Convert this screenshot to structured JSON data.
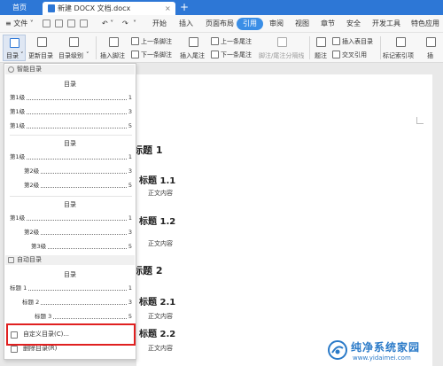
{
  "titlebar": {
    "home_tab": "首页",
    "doc_tab": "新建 DOCX 文档.docx",
    "close": "×",
    "add": "+"
  },
  "menu": {
    "file": "≡ 文件 ˅",
    "items": [
      "开始",
      "插入",
      "页面布局",
      "引用",
      "审阅",
      "视图",
      "章节",
      "安全",
      "开发工具",
      "特色应用"
    ],
    "active": "引用"
  },
  "ribbon": {
    "toc": "目录",
    "update_toc": "更新目录",
    "toc_level": "目录级别",
    "insert_footnote": "插入脚注",
    "prev_footnote": "上一条脚注",
    "next_footnote": "下一条脚注",
    "insert_endnote": "插入尾注",
    "prev_endnote": "上一条尾注",
    "next_endnote": "下一条尾注",
    "footnote_separator": "脚注/尾注分隔线",
    "caption": "题注",
    "insert_table_of_figures": "插入表目录",
    "cross_reference": "交叉引用",
    "mark_index": "标记索引项",
    "insert_index": "插"
  },
  "toc_dropdown": {
    "smart_toc_header": "智能目录",
    "blocks": [
      {
        "title": "目录",
        "lines": [
          {
            "label": "第1级",
            "page": "1"
          },
          {
            "label": "第1级",
            "page": "3"
          },
          {
            "label": "第1级",
            "page": "5"
          }
        ]
      },
      {
        "title": "目录",
        "lines": [
          {
            "label": "第1级",
            "page": "1"
          },
          {
            "label": "第2级",
            "page": "3"
          },
          {
            "label": "第2级",
            "page": "5"
          }
        ]
      },
      {
        "title": "目录",
        "lines": [
          {
            "label": "第1级",
            "page": "1"
          },
          {
            "label": "第2级",
            "page": "3"
          },
          {
            "label": "第3级",
            "page": "5"
          }
        ]
      }
    ],
    "auto_toc_header": "自动目录",
    "auto_block": {
      "title": "目录",
      "lines": [
        {
          "label": "标题 1",
          "page": "1"
        },
        {
          "label": "标题 2",
          "page": "3"
        },
        {
          "label": "标题 3",
          "page": "5"
        }
      ]
    },
    "custom_toc": "自定义目录(C)...",
    "delete_toc": "删除目录(R)"
  },
  "document": {
    "items": [
      {
        "type": "h1",
        "text": "标题 1"
      },
      {
        "type": "h2",
        "text": "标题 1.1"
      },
      {
        "type": "body",
        "text": "正文内容"
      },
      {
        "type": "h2",
        "text": "标题 1.2"
      },
      {
        "type": "body",
        "text": "正文内容"
      },
      {
        "type": "h1",
        "text": "标题 2"
      },
      {
        "type": "h2",
        "text": "标题 2.1"
      },
      {
        "type": "body",
        "text": "正文内容"
      },
      {
        "type": "h2",
        "text": "标题 2.2"
      },
      {
        "type": "body",
        "text": "正文内容"
      }
    ]
  },
  "watermark": {
    "name": "纯净系统家园",
    "url": "www.yidaimei.com"
  },
  "colors": {
    "titlebar": "#2d77d6",
    "active_tab": "#3a8ee6",
    "highlight": "#e02020",
    "watermark": "#2a7ac8"
  }
}
